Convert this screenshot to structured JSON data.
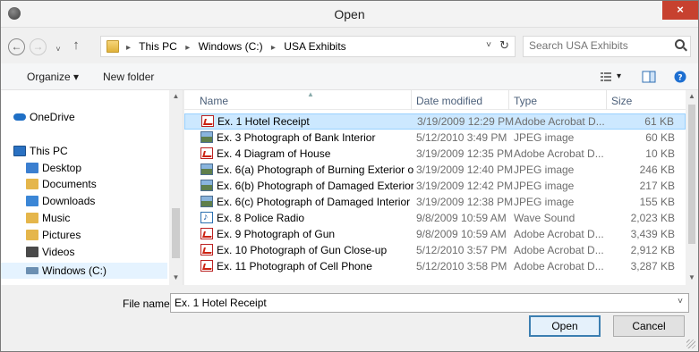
{
  "window": {
    "title": "Open",
    "close_glyph": "×"
  },
  "nav": {
    "back_glyph": "←",
    "forward_glyph": "→",
    "up_glyph": "↑",
    "recent_glyph": "˅"
  },
  "address": {
    "crumbs": [
      "This PC",
      "Windows (C:)",
      "USA Exhibits"
    ],
    "separator": "▸",
    "dropdown_glyph": "˅",
    "refresh_glyph": "↻"
  },
  "search": {
    "placeholder": "Search USA Exhibits"
  },
  "toolbar": {
    "organize_label": "Organize ▾",
    "new_folder_label": "New folder",
    "view_dd_glyph": "▾"
  },
  "sidebar": {
    "items": [
      {
        "label": "OneDrive",
        "icon": "cloud-icon",
        "color": "#1f6fc5"
      },
      {
        "label": "This PC",
        "icon": "computer-icon",
        "color": "#2a71c2"
      },
      {
        "label": "Desktop",
        "icon": "folder-desktop-icon",
        "color": "#3b7fd0"
      },
      {
        "label": "Documents",
        "icon": "folder-documents-icon",
        "color": "#e5b64b"
      },
      {
        "label": "Downloads",
        "icon": "folder-downloads-icon",
        "color": "#3b86d6"
      },
      {
        "label": "Music",
        "icon": "folder-music-icon",
        "color": "#e5b64b"
      },
      {
        "label": "Pictures",
        "icon": "folder-pictures-icon",
        "color": "#e5b64b"
      },
      {
        "label": "Videos",
        "icon": "folder-videos-icon",
        "color": "#4a4a4a"
      },
      {
        "label": "Windows (C:)",
        "icon": "drive-icon",
        "color": "#6b8fb2"
      }
    ]
  },
  "files": {
    "columns": {
      "name": "Name",
      "date": "Date modified",
      "type": "Type",
      "size": "Size"
    },
    "rows": [
      {
        "name": "Ex. 1 Hotel Receipt",
        "date": "3/19/2009 12:29 PM",
        "type": "Adobe Acrobat D...",
        "size": "61 KB",
        "icon": "pdf-icon"
      },
      {
        "name": "Ex. 3 Photograph of Bank Interior",
        "date": "5/12/2010 3:49 PM",
        "type": "JPEG image",
        "size": "60 KB",
        "icon": "jpeg-icon"
      },
      {
        "name": "Ex. 4 Diagram of House",
        "date": "3/19/2009 12:35 PM",
        "type": "Adobe Acrobat D...",
        "size": "10 KB",
        "icon": "pdf-icon"
      },
      {
        "name": "Ex. 6(a) Photograph of Burning Exterior o...",
        "date": "3/19/2009 12:40 PM",
        "type": "JPEG image",
        "size": "246 KB",
        "icon": "jpeg-icon"
      },
      {
        "name": "Ex. 6(b) Photograph of Damaged Exterior ...",
        "date": "3/19/2009 12:42 PM",
        "type": "JPEG image",
        "size": "217 KB",
        "icon": "jpeg-icon"
      },
      {
        "name": "Ex. 6(c) Photograph of Damaged Interior ...",
        "date": "3/19/2009 12:38 PM",
        "type": "JPEG image",
        "size": "155 KB",
        "icon": "jpeg-icon"
      },
      {
        "name": "Ex. 8 Police Radio",
        "date": "9/8/2009 10:59 AM",
        "type": "Wave Sound",
        "size": "2,023 KB",
        "icon": "wave-icon"
      },
      {
        "name": "Ex. 9 Photograph of Gun",
        "date": "9/8/2009 10:59 AM",
        "type": "Adobe Acrobat D...",
        "size": "3,439 KB",
        "icon": "pdf-icon"
      },
      {
        "name": "Ex. 10 Photograph of Gun Close-up",
        "date": "5/12/2010 3:57 PM",
        "type": "Adobe Acrobat D...",
        "size": "2,912 KB",
        "icon": "pdf-icon"
      },
      {
        "name": "Ex. 11 Photograph of Cell Phone",
        "date": "5/12/2010 3:58 PM",
        "type": "Adobe Acrobat D...",
        "size": "3,287 KB",
        "icon": "pdf-icon"
      }
    ]
  },
  "bottom": {
    "file_name_label": "File name:",
    "file_name_value": "Ex. 1 Hotel Receipt",
    "file_name_dd_glyph": "˅",
    "open_label": "Open",
    "cancel_label": "Cancel"
  },
  "colors": {
    "close_button": "#c7412f",
    "selection": "#cce8ff",
    "header_text": "#4c607a"
  }
}
